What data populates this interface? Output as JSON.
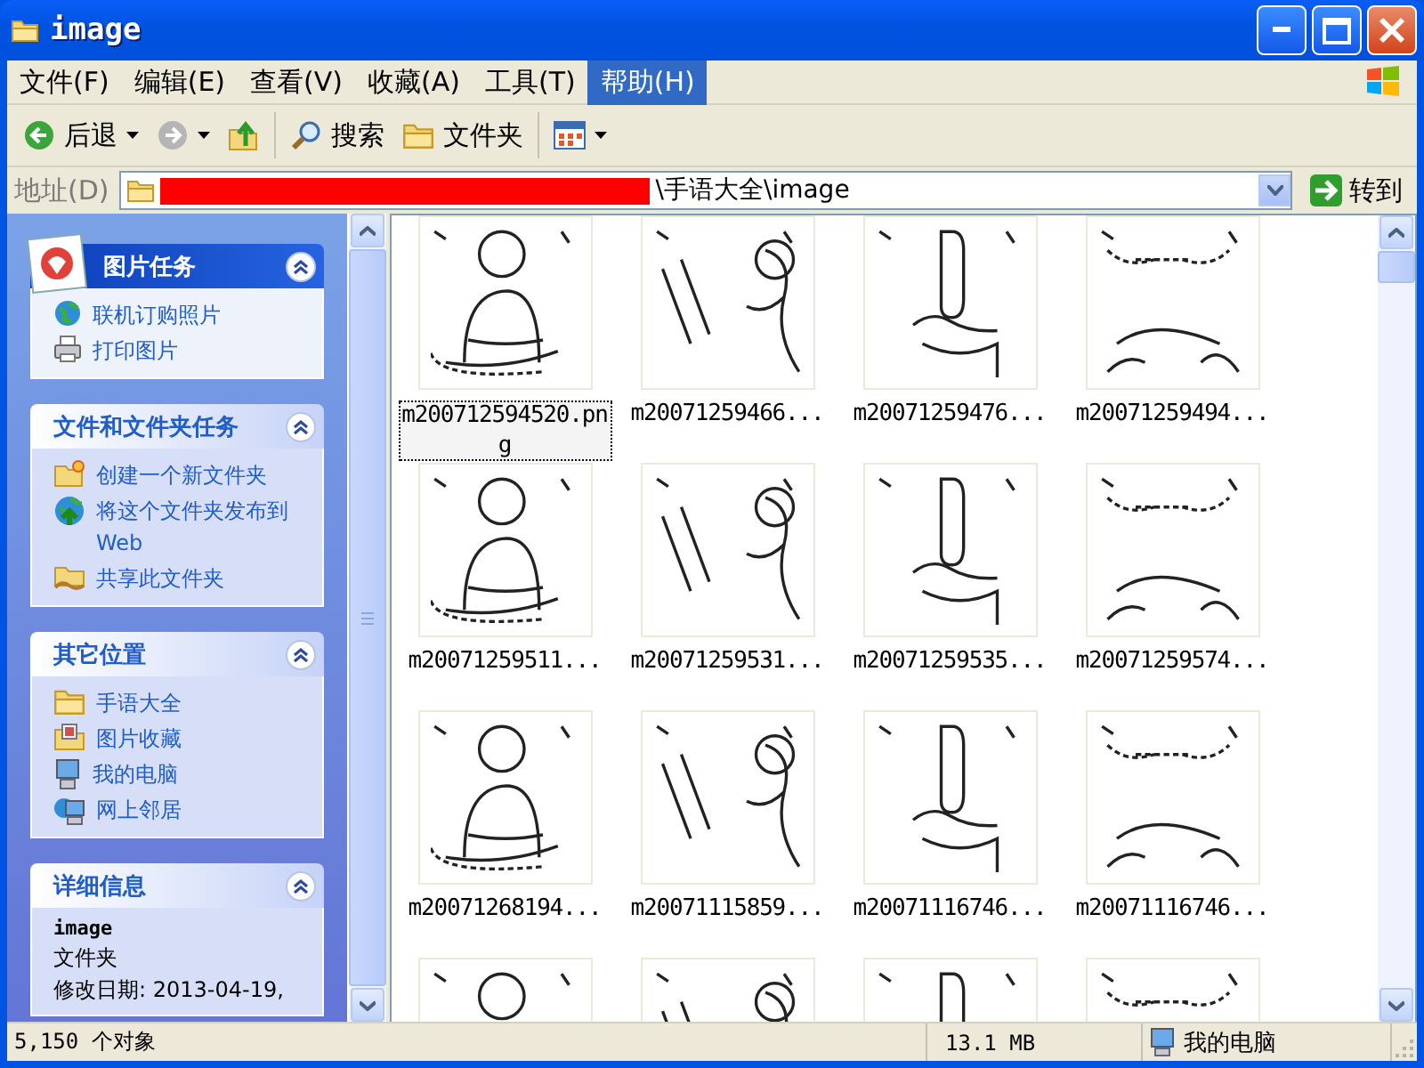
{
  "window": {
    "title": "image"
  },
  "menu": [
    {
      "label": "文件(F)",
      "selected": false
    },
    {
      "label": "编辑(E)",
      "selected": false
    },
    {
      "label": "查看(V)",
      "selected": false
    },
    {
      "label": "收藏(A)",
      "selected": false
    },
    {
      "label": "工具(T)",
      "selected": false
    },
    {
      "label": "帮助(H)",
      "selected": true
    }
  ],
  "toolbar": [
    {
      "kind": "back",
      "label": "后退",
      "disabled": false
    },
    {
      "kind": "forward",
      "disabled": true
    },
    {
      "kind": "up",
      "disabled": false
    },
    {
      "kind": "search",
      "label": "搜索",
      "disabled": false
    },
    {
      "kind": "folders",
      "label": "文件夹",
      "disabled": false
    },
    {
      "kind": "views",
      "disabled": false
    }
  ],
  "address": {
    "label": "地址(D)",
    "value": "\\手语大全\\image",
    "go": "转到"
  },
  "task_pane": {
    "sections": [
      {
        "kind": "picture",
        "title": "图片任务",
        "expanded": true,
        "items": [
          {
            "kind": "globe",
            "label": "联机订购照片"
          },
          {
            "kind": "printer",
            "label": "打印图片"
          }
        ]
      },
      {
        "kind": "plain",
        "title": "文件和文件夹任务",
        "expanded": true,
        "items": [
          {
            "kind": "new-folder",
            "label": "创建一个新文件夹"
          },
          {
            "kind": "publish",
            "label": "将这个文件夹发布到 Web"
          },
          {
            "kind": "share",
            "label": "共享此文件夹"
          }
        ]
      },
      {
        "kind": "plain",
        "title": "其它位置",
        "expanded": true,
        "items": [
          {
            "kind": "folder",
            "label": "手语大全"
          },
          {
            "kind": "pictures",
            "label": "图片收藏"
          },
          {
            "kind": "computer",
            "label": "我的电脑"
          },
          {
            "kind": "network",
            "label": "网上邻居"
          }
        ]
      },
      {
        "kind": "details",
        "title": "详细信息",
        "expanded": true,
        "name": "image",
        "type": "文件夹",
        "modified": "修改日期: 2013-04-19,"
      }
    ]
  },
  "files": [
    {
      "name": "m200712594520.png",
      "focused": true
    },
    {
      "name": "m20071259466...",
      "focused": false
    },
    {
      "name": "m20071259476...",
      "focused": false
    },
    {
      "name": "m20071259494...",
      "focused": false
    },
    {
      "name": "m20071259511...",
      "focused": false
    },
    {
      "name": "m20071259531...",
      "focused": false
    },
    {
      "name": "m20071259535...",
      "focused": false
    },
    {
      "name": "m20071259574...",
      "focused": false
    },
    {
      "name": "m20071268194...",
      "focused": false
    },
    {
      "name": "m20071115859...",
      "focused": false
    },
    {
      "name": "m20071116746...",
      "focused": false
    },
    {
      "name": "m20071116746...",
      "focused": false
    },
    {
      "focused": false
    },
    {
      "focused": false
    },
    {
      "focused": false
    },
    {
      "focused": false
    }
  ],
  "status_bar": {
    "objects": "5,150 个对象",
    "size": "13.1 MB",
    "zone": "我的电脑"
  }
}
